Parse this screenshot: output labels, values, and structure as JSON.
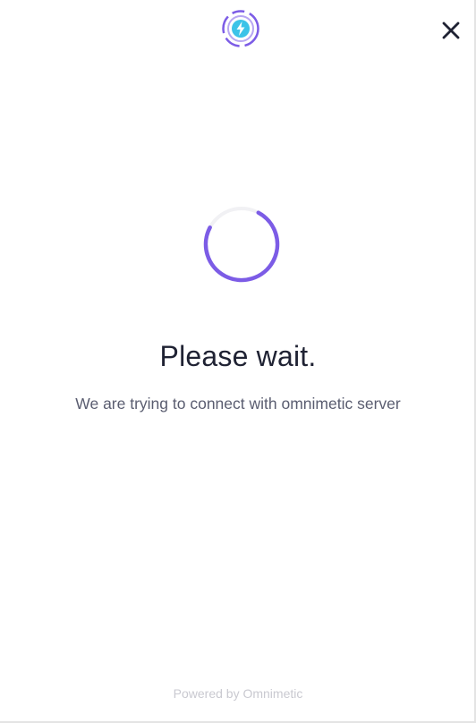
{
  "header": {
    "logo_icon": "omnimetic-logo-icon",
    "close_icon": "close-icon"
  },
  "status": {
    "spinner_icon": "loading-spinner-icon",
    "title": "Please wait.",
    "message": "We are trying to connect with omnimetic server"
  },
  "footer": {
    "text": "Powered by Omnimetic"
  },
  "colors": {
    "accent": "#7c5ce6",
    "logo_inner": "#3cc3e8",
    "title": "#1f2233",
    "message": "#5a5d70",
    "footer": "#c9c9d0"
  }
}
